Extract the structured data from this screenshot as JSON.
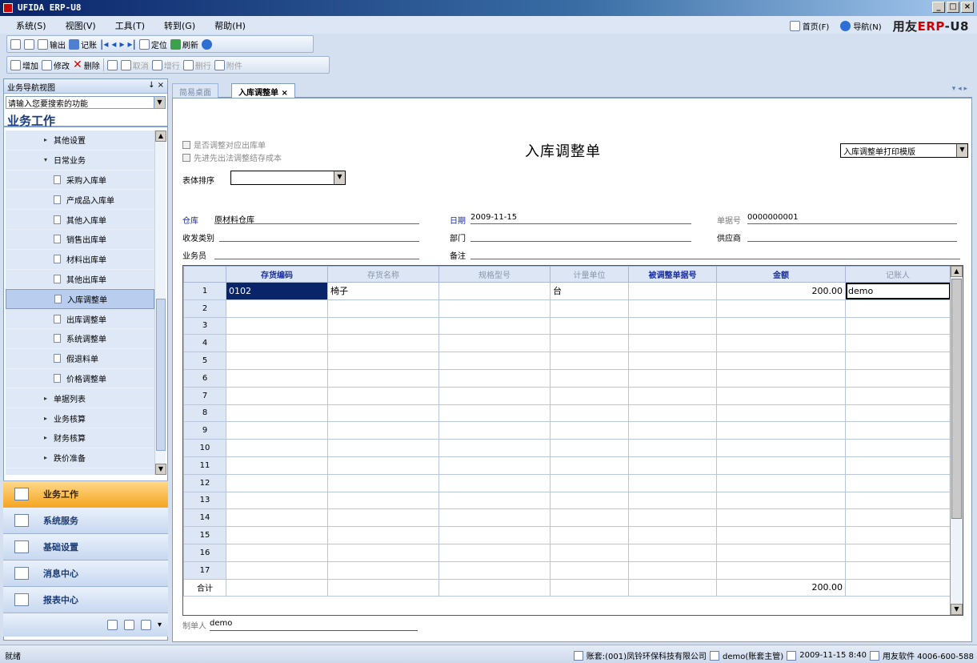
{
  "window": {
    "title": "UFIDA ERP-U8",
    "minimize": "_",
    "restore": "□",
    "close": "×"
  },
  "menu": [
    "系统(S)",
    "视图(V)",
    "工具(T)",
    "转到(G)",
    "帮助(H)"
  ],
  "top_links": {
    "home": "首页(F)",
    "nav": "导航(N)",
    "brand_prefix": "用友",
    "brand_erp": "ERP",
    "brand_suffix": "-U8"
  },
  "toolbar1": {
    "print": "",
    "preview": "",
    "output": "输出",
    "record": "记账",
    "locate": "定位",
    "refresh": "刷新"
  },
  "toolbar2": {
    "add": "增加",
    "edit": "修改",
    "delete": "删除",
    "cancel": "取消",
    "add_row": "增行",
    "del_row": "删行",
    "attach": "附件"
  },
  "left_panel": {
    "header": "业务导航视图",
    "header_pin": "↓ ×",
    "search_placeholder": "请输入您要搜索的功能",
    "title": "业务工作",
    "tree": [
      {
        "label": "其他设置",
        "type": "bullet"
      },
      {
        "label": "日常业务",
        "type": "expanded"
      },
      {
        "label": "采购入库单",
        "type": "doc"
      },
      {
        "label": "产成品入库单",
        "type": "doc"
      },
      {
        "label": "其他入库单",
        "type": "doc"
      },
      {
        "label": "销售出库单",
        "type": "doc"
      },
      {
        "label": "材料出库单",
        "type": "doc"
      },
      {
        "label": "其他出库单",
        "type": "doc"
      },
      {
        "label": "入库调整单",
        "type": "doc",
        "selected": true
      },
      {
        "label": "出库调整单",
        "type": "doc"
      },
      {
        "label": "系统调整单",
        "type": "doc"
      },
      {
        "label": "假退料单",
        "type": "doc"
      },
      {
        "label": "价格调整单",
        "type": "doc"
      },
      {
        "label": "单据列表",
        "type": "bullet"
      },
      {
        "label": "业务核算",
        "type": "bullet0"
      },
      {
        "label": "财务核算",
        "type": "bullet0"
      },
      {
        "label": "跌价准备",
        "type": "bullet0"
      }
    ],
    "modules": [
      "业务工作",
      "系统服务",
      "基础设置",
      "消息中心",
      "报表中心"
    ]
  },
  "tabs": {
    "desk": "简易桌面",
    "active": "入库调整单",
    "close": "×",
    "controls": "▾ ◂ ▸"
  },
  "form": {
    "check1": "是否调整对应出库单",
    "check2": "先进先出法调整结存成本",
    "title": "入库调整单",
    "template": "入库调整单打印模版",
    "sort_label": "表体排序",
    "warehouse_label": "仓库",
    "warehouse": "原材料仓库",
    "date_label": "日期",
    "date": "2009-11-15",
    "no_label": "单据号",
    "no": "0000000001",
    "type_label": "收发类别",
    "dept_label": "部门",
    "supplier_label": "供应商",
    "clerk_label": "业务员",
    "memo_label": "备注",
    "maker_label": "制单人",
    "maker": "demo"
  },
  "grid": {
    "headers": [
      "",
      "存货编码",
      "存货名称",
      "规格型号",
      "计量单位",
      "被调整单据号",
      "金额",
      "记账人"
    ],
    "rows": [
      [
        "1",
        "0102",
        "椅子",
        "",
        "台",
        "",
        "200.00",
        "demo"
      ],
      [
        "2",
        "",
        "",
        "",
        "",
        "",
        "",
        ""
      ],
      [
        "3",
        "",
        "",
        "",
        "",
        "",
        "",
        ""
      ],
      [
        "4",
        "",
        "",
        "",
        "",
        "",
        "",
        ""
      ],
      [
        "5",
        "",
        "",
        "",
        "",
        "",
        "",
        ""
      ],
      [
        "6",
        "",
        "",
        "",
        "",
        "",
        "",
        ""
      ],
      [
        "7",
        "",
        "",
        "",
        "",
        "",
        "",
        ""
      ],
      [
        "8",
        "",
        "",
        "",
        "",
        "",
        "",
        ""
      ],
      [
        "9",
        "",
        "",
        "",
        "",
        "",
        "",
        ""
      ],
      [
        "10",
        "",
        "",
        "",
        "",
        "",
        "",
        ""
      ],
      [
        "11",
        "",
        "",
        "",
        "",
        "",
        "",
        ""
      ],
      [
        "12",
        "",
        "",
        "",
        "",
        "",
        "",
        ""
      ],
      [
        "13",
        "",
        "",
        "",
        "",
        "",
        "",
        ""
      ],
      [
        "14",
        "",
        "",
        "",
        "",
        "",
        "",
        ""
      ],
      [
        "15",
        "",
        "",
        "",
        "",
        "",
        "",
        ""
      ],
      [
        "16",
        "",
        "",
        "",
        "",
        "",
        "",
        ""
      ],
      [
        "17",
        "",
        "",
        "",
        "",
        "",
        "",
        ""
      ]
    ],
    "total_label": "合计",
    "total_amount": "200.00"
  },
  "status": {
    "ready": "就绪",
    "account": "账套:(001)凤铃环保科技有限公司",
    "user": "demo(账套主管)",
    "datetime": "2009-11-15 8:40",
    "hotline": "用友软件 4006-600-588"
  },
  "colors": {
    "title_bar": "#0a246a",
    "accent_module": "#f5a623",
    "selected_cell": "#0a246a",
    "brand_red": "#d40000"
  }
}
